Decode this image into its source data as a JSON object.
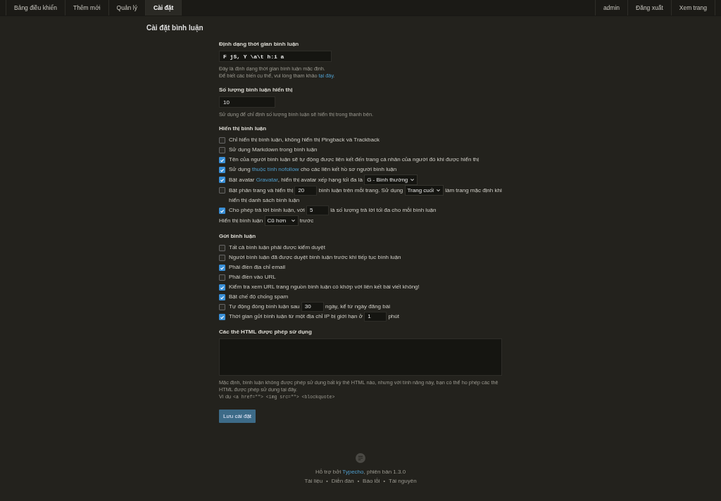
{
  "nav": {
    "left": [
      {
        "label": "Bảng điều khiển",
        "selected": false
      },
      {
        "label": "Thêm mới",
        "selected": false
      },
      {
        "label": "Quản lý",
        "selected": false
      },
      {
        "label": "Cài đặt",
        "selected": true
      }
    ],
    "right": [
      "admin",
      "Đăng xuất",
      "Xem trang"
    ]
  },
  "title": "Cài đặt bình luận",
  "sections": [
    {
      "kind": "format_field",
      "label": "Định dạng thời gian bình luận",
      "value": "F jS, Y \\a\\t h:i a",
      "help": [
        [
          {
            "kind": "text",
            "text": "Đây là định dạng thời gian bình luận mặc định."
          }
        ],
        [
          {
            "kind": "text",
            "text": "Để biết các biến cụ thể, vui lòng tham khảo "
          },
          {
            "kind": "link",
            "text": "tại đây"
          },
          {
            "kind": "text",
            "text": "."
          }
        ]
      ]
    },
    {
      "kind": "number_field",
      "label": "Số lượng bình luận hiển thị",
      "value": "10",
      "help": [
        [
          {
            "kind": "text",
            "text": "Sử dụng để chỉ định số lượng bình luận sẽ hiển thị trong thanh bên."
          }
        ]
      ]
    },
    {
      "kind": "options",
      "label": "Hiển thị bình luận",
      "options": [
        {
          "kind": "checkbox",
          "checked": false,
          "parts": [
            {
              "kind": "text",
              "text": "Chỉ hiển thị bình luận, không hiển thị Pingback và Trackback"
            }
          ]
        },
        {
          "kind": "checkbox",
          "checked": false,
          "parts": [
            {
              "kind": "text",
              "text": "Sử dụng Markdown trong bình luận"
            }
          ]
        },
        {
          "kind": "checkbox",
          "checked": true,
          "parts": [
            {
              "kind": "text",
              "text": "Tên của người bình luận sẽ tự động được liên kết đến trang cá nhân của người đó khi được hiển thị"
            }
          ]
        },
        {
          "kind": "checkbox",
          "checked": true,
          "parts": [
            {
              "kind": "text",
              "text": "Sử dụng "
            },
            {
              "kind": "link",
              "text": "thuộc tính nofollow"
            },
            {
              "kind": "text",
              "text": " cho các liên kết hồ sơ người bình luận"
            }
          ]
        },
        {
          "kind": "checkbox",
          "checked": true,
          "parts": [
            {
              "kind": "text",
              "text": "Bật avatar "
            },
            {
              "kind": "link",
              "text": "Gravatar"
            },
            {
              "kind": "text",
              "text": ", hiển thị avatar xếp hạng tối đa là "
            },
            {
              "kind": "select",
              "text": "G - Bình thường"
            }
          ]
        },
        {
          "kind": "checkbox",
          "checked": false,
          "parts": [
            {
              "kind": "text",
              "text": "Bật phân trang và hiển thị "
            },
            {
              "kind": "input",
              "text": "20"
            },
            {
              "kind": "text",
              "text": " bình luận trên mỗi trang. Sử dụng "
            },
            {
              "kind": "select",
              "text": "Trang cuối"
            },
            {
              "kind": "text",
              "text": " làm trang mặc định khi "
            },
            {
              "kind": "text",
              "text": "hiển thị danh sách bình luận"
            }
          ]
        },
        {
          "kind": "checkbox",
          "checked": true,
          "parts": [
            {
              "kind": "text",
              "text": "Cho phép trả lời bình luận, với "
            },
            {
              "kind": "input",
              "text": "5"
            },
            {
              "kind": "text",
              "text": " là số lượng trả lời tối đa cho mỗi bình luận"
            }
          ]
        },
        {
          "kind": "plain",
          "parts": [
            {
              "kind": "text",
              "text": "Hiển thị bình luận "
            },
            {
              "kind": "select",
              "text": "Cũ hơn"
            },
            {
              "kind": "text",
              "text": " trước"
            }
          ]
        }
      ]
    },
    {
      "kind": "options",
      "label": "Gửi bình luận",
      "options": [
        {
          "kind": "checkbox",
          "checked": false,
          "parts": [
            {
              "kind": "text",
              "text": "Tất cả bình luận phải được kiểm duyệt"
            }
          ]
        },
        {
          "kind": "checkbox",
          "checked": false,
          "parts": [
            {
              "kind": "text",
              "text": "Người bình luận đã được duyệt bình luận trước khi tiếp tục bình luận"
            }
          ]
        },
        {
          "kind": "checkbox",
          "checked": true,
          "parts": [
            {
              "kind": "text",
              "text": "Phải điền địa chỉ email"
            }
          ]
        },
        {
          "kind": "checkbox",
          "checked": false,
          "parts": [
            {
              "kind": "text",
              "text": "Phải điền vào URL"
            }
          ]
        },
        {
          "kind": "checkbox",
          "checked": true,
          "parts": [
            {
              "kind": "text",
              "text": "Kiểm tra xem URL trang nguồn bình luận có khớp với liên kết bài viết không!"
            }
          ]
        },
        {
          "kind": "checkbox",
          "checked": true,
          "parts": [
            {
              "kind": "text",
              "text": "Bật chế độ chống spam"
            }
          ]
        },
        {
          "kind": "checkbox",
          "checked": false,
          "parts": [
            {
              "kind": "text",
              "text": "Tự động đóng bình luận sau "
            },
            {
              "kind": "input",
              "text": "30"
            },
            {
              "kind": "text",
              "text": " ngày, kể từ ngày đăng bài"
            }
          ]
        },
        {
          "kind": "checkbox",
          "checked": true,
          "parts": [
            {
              "kind": "text",
              "text": "Thời gian gửi bình luận từ một địa chỉ IP bị giới hạn ở "
            },
            {
              "kind": "input",
              "text": "1"
            },
            {
              "kind": "text",
              "text": " phút"
            }
          ]
        }
      ]
    },
    {
      "kind": "textarea",
      "label": "Các thẻ HTML được phép sử dụng",
      "help": [
        [
          {
            "kind": "text",
            "text": "Mặc định, bình luận không được phép sử dụng bất kỳ thẻ HTML nào, nhưng với tính năng này, bạn có thể ho phép các thẻ HTML được phép sử dụng tại đây."
          }
        ],
        [
          {
            "kind": "text",
            "text": "Ví dụ"
          },
          {
            "kind": "code",
            "text": "<a href=\"\"> <img src=\"\"> <blockquote>"
          }
        ]
      ]
    }
  ],
  "save_button": "Lưu cài đặt",
  "footer": {
    "credit": [
      {
        "kind": "text",
        "text": "Hỗ trợ bởi "
      },
      {
        "kind": "link",
        "text": "Typecho"
      },
      {
        "kind": "text",
        "text": ", phiên bản 1.3.0"
      }
    ],
    "links": [
      "Tài liệu",
      "Diễn đàn",
      "Báo lỗi",
      "Tài nguyên"
    ],
    "separators": [
      "•",
      "•",
      "•"
    ]
  }
}
